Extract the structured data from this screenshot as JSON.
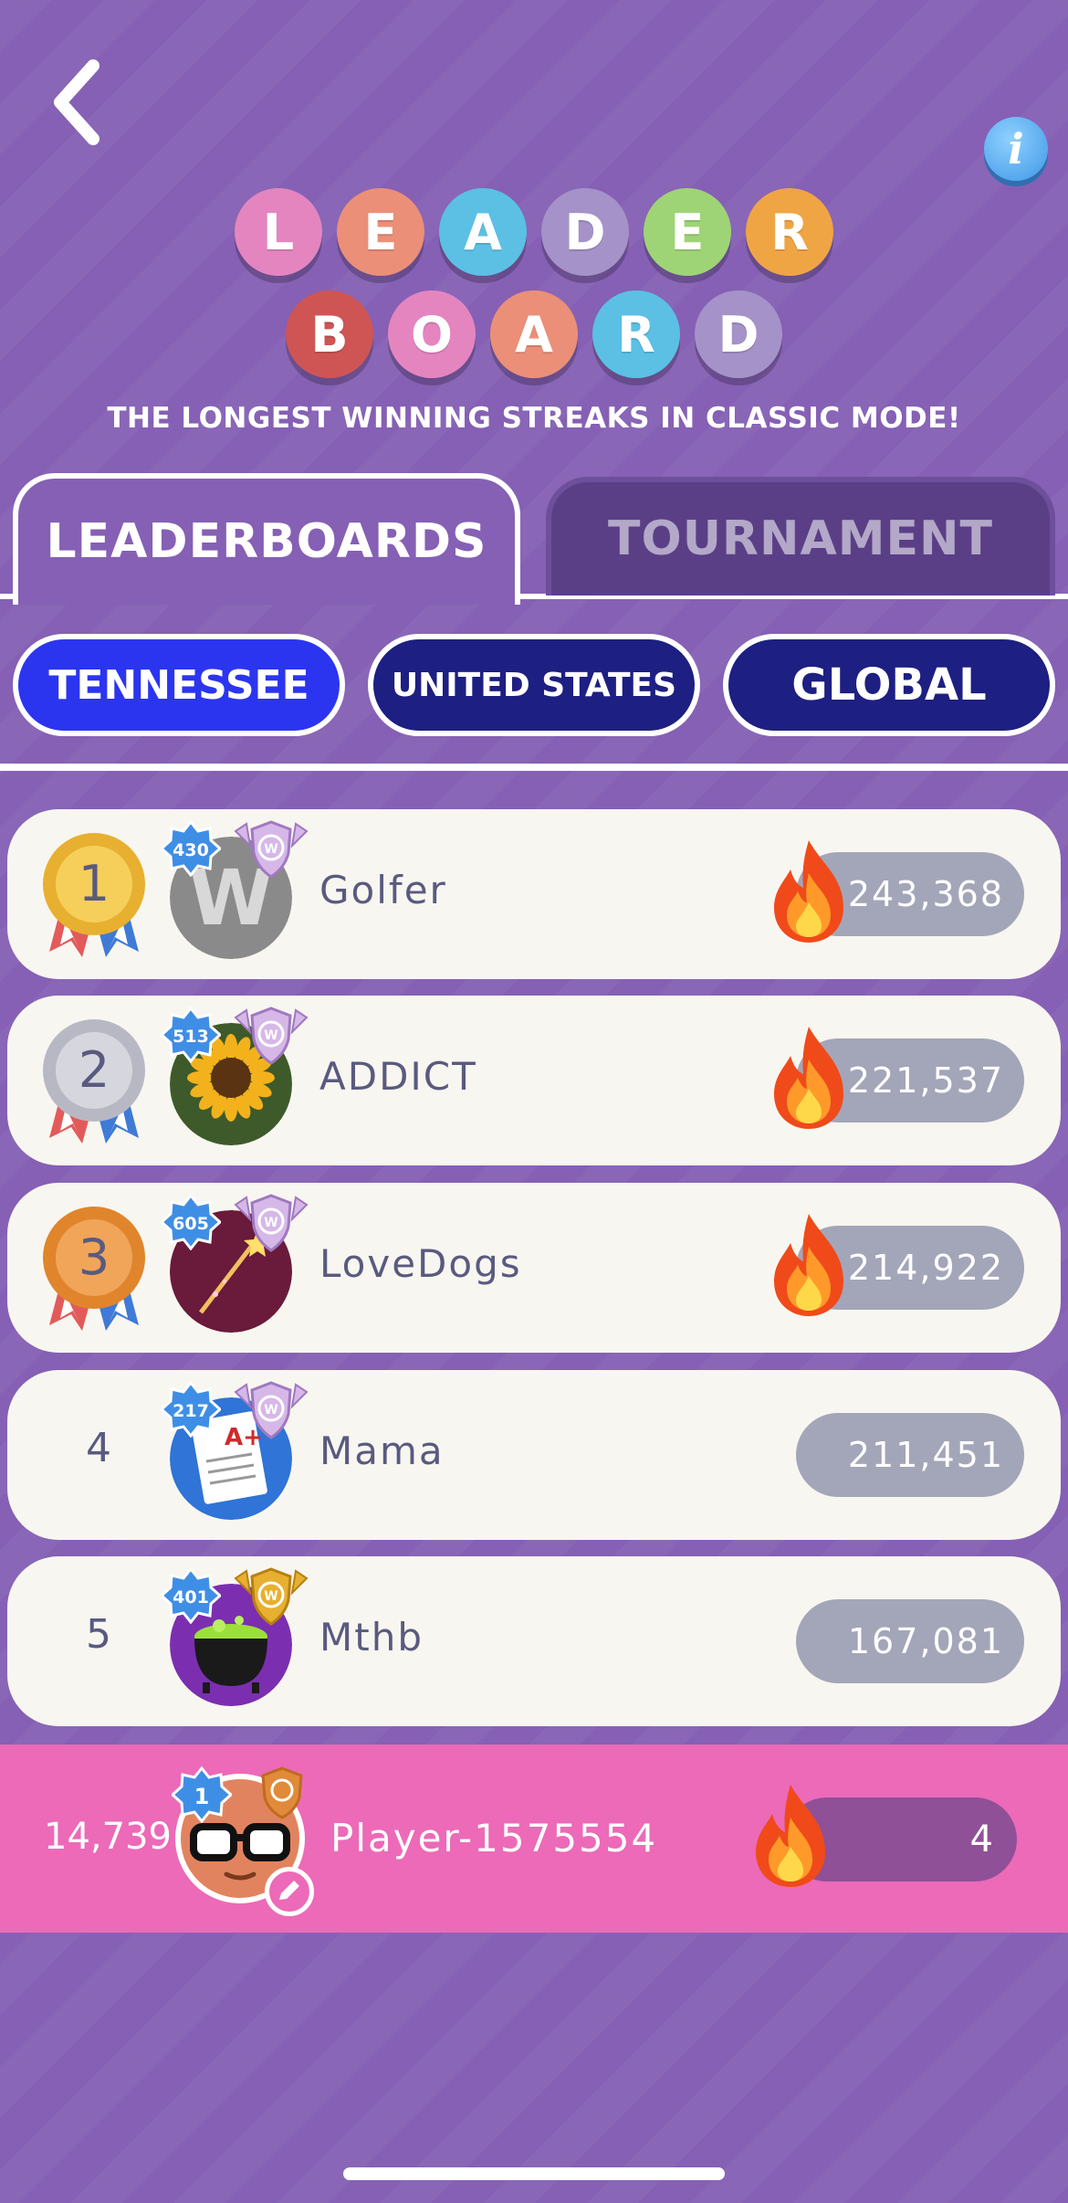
{
  "header": {
    "title_row_1": [
      "L",
      "E",
      "A",
      "D",
      "E",
      "R"
    ],
    "title_row_2": [
      "B",
      "O",
      "A",
      "R",
      "D"
    ],
    "title_colors_row_1": [
      "#e485c0",
      "#eb8f78",
      "#5bc0e4",
      "#a592c9",
      "#9fd476",
      "#f0a545"
    ],
    "title_colors_row_2": [
      "#cf5555",
      "#e485c0",
      "#eb8f78",
      "#5bc0e4",
      "#a592c9"
    ],
    "subtitle": "THE LONGEST WINNING STREAKS IN CLASSIC MODE!",
    "info_label": "i"
  },
  "tabs": {
    "leaderboards": "LEADERBOARDS",
    "tournament": "TOURNAMENT"
  },
  "filters": {
    "tennessee": "TENNESSEE",
    "united_states": "UNITED STATES",
    "global": "GLOBAL",
    "selected": "TENNESSEE"
  },
  "entries": [
    {
      "rank": "1",
      "name": "Golfer",
      "level": "430",
      "score": "243,368",
      "avatar": "letter-w-avatar",
      "shield": "purple-shield",
      "streak_fire": true
    },
    {
      "rank": "2",
      "name": "ADDICT",
      "level": "513",
      "score": "221,537",
      "avatar": "sunflower-avatar",
      "shield": "purple-shield",
      "streak_fire": true
    },
    {
      "rank": "3",
      "name": "LoveDogs",
      "level": "605",
      "score": "214,922",
      "avatar": "magic-wand-avatar",
      "shield": "purple-shield",
      "streak_fire": true
    },
    {
      "rank": "4",
      "name": "Mama",
      "level": "217",
      "score": "211,451",
      "avatar": "test-paper-avatar",
      "shield": "purple-shield",
      "streak_fire": false
    },
    {
      "rank": "5",
      "name": "Mthb",
      "level": "401",
      "score": "167,081",
      "avatar": "cauldron-avatar",
      "shield": "gold-shield",
      "streak_fire": false
    }
  ],
  "current_player": {
    "rank": "14,739",
    "name": "Player-1575554",
    "level": "1",
    "score": "4",
    "avatar": "glasses-face-avatar"
  },
  "colors": {
    "background": "#8560b4",
    "row_background": "#f8f6f0",
    "score_pill": "#a3a6b8",
    "player_bar": "#ec6ab8",
    "selected_filter": "#2b35f0",
    "unselected_filter": "#1d1f82",
    "gold": "#e8b030",
    "silver": "#b8b8c4",
    "bronze": "#e0852c"
  }
}
